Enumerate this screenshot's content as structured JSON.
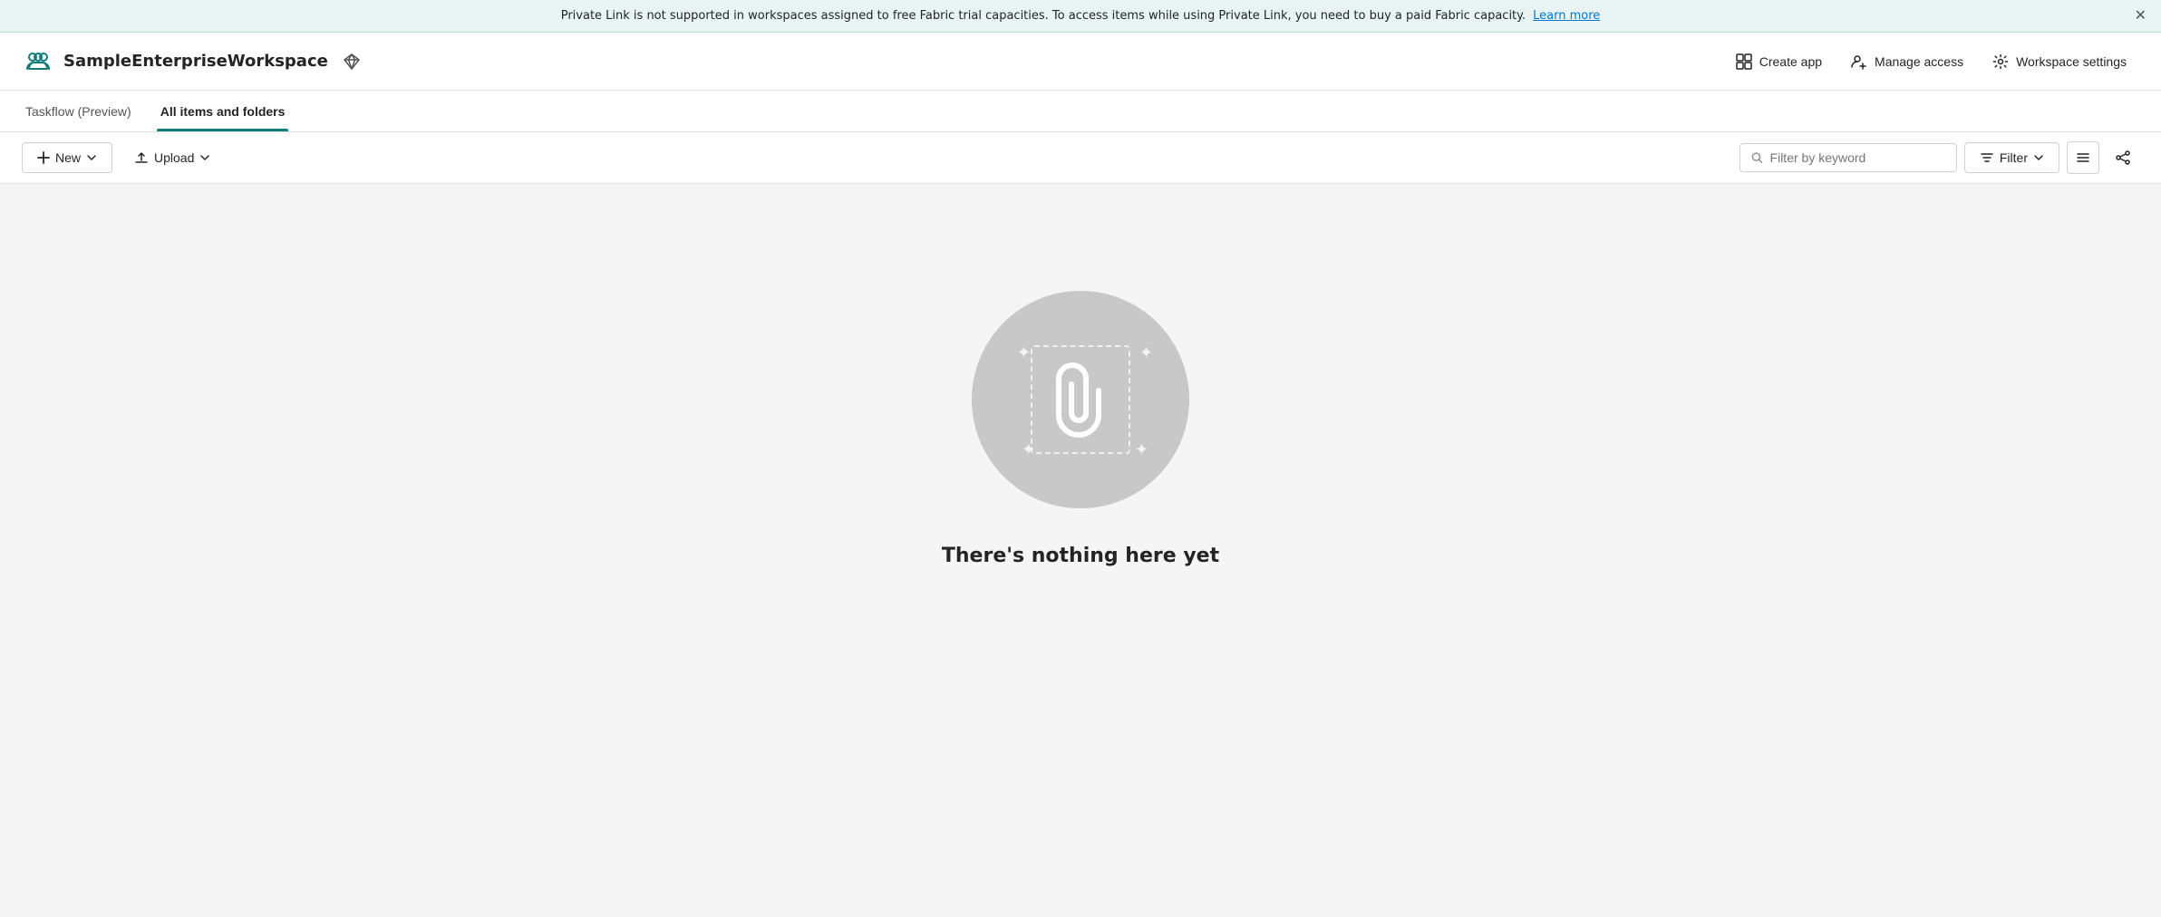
{
  "banner": {
    "message": "Private Link is not supported in workspaces assigned to free Fabric trial capacities. To access items while using Private Link, you need to buy a paid Fabric capacity.",
    "learn_more": "Learn more",
    "close_label": "✕"
  },
  "header": {
    "workspace_name": "SampleEnterpriseWorkspace",
    "create_app_label": "Create app",
    "manage_access_label": "Manage access",
    "workspace_settings_label": "Workspace settings"
  },
  "tabs": [
    {
      "id": "taskflow",
      "label": "Taskflow (Preview)",
      "active": false
    },
    {
      "id": "all-items",
      "label": "All items and folders",
      "active": true
    }
  ],
  "toolbar": {
    "new_label": "New",
    "upload_label": "Upload",
    "filter_placeholder": "Filter by keyword",
    "filter_label": "Filter"
  },
  "empty_state": {
    "title": "There's nothing here yet"
  }
}
